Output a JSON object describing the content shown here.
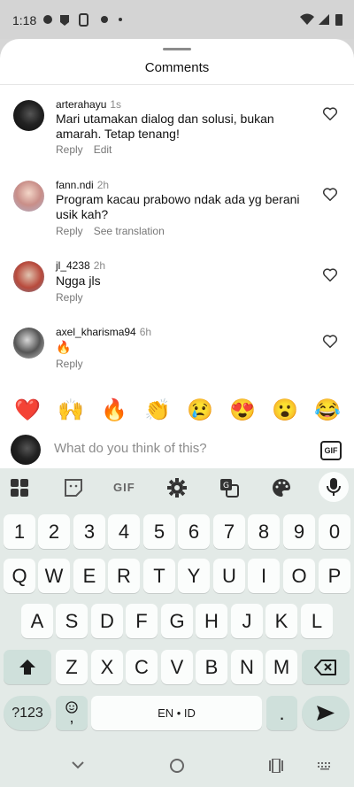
{
  "status_bar": {
    "time": "1:18"
  },
  "sheet": {
    "title": "Comments"
  },
  "comments": [
    {
      "username": "arterahayu",
      "time": "1s",
      "text_line1": "Mari utamakan dialog dan solusi, bukan",
      "text_line2": "amarah. Tetap tenang!",
      "action1": "Reply",
      "action2": "Edit"
    },
    {
      "username": "fann.ndi",
      "time": "2h",
      "text_line1": "Program kacau prabowo ndak ada yg  berani",
      "text_line2": "usik kah?",
      "action1": "Reply",
      "action2": "See translation"
    },
    {
      "username": "jl_4238",
      "time": "2h",
      "text_line1": "Ngga jls",
      "text_line2": "",
      "action1": "Reply",
      "action2": ""
    },
    {
      "username": "axel_kharisma94",
      "time": "6h",
      "text_line1": "🔥",
      "text_line2": "",
      "action1": "Reply",
      "action2": ""
    }
  ],
  "emoji_bar": [
    "❤️",
    "🙌",
    "🔥",
    "👏",
    "😢",
    "😍",
    "😮",
    "😂"
  ],
  "input": {
    "placeholder": "What do you think of this?",
    "gif_label": "GIF"
  },
  "keyboard": {
    "toolbar_gif": "GIF",
    "row_numbers": [
      "1",
      "2",
      "3",
      "4",
      "5",
      "6",
      "7",
      "8",
      "9",
      "0"
    ],
    "row1": [
      "Q",
      "W",
      "E",
      "R",
      "T",
      "Y",
      "U",
      "I",
      "O",
      "P"
    ],
    "row2": [
      "A",
      "S",
      "D",
      "F",
      "G",
      "H",
      "J",
      "K",
      "L"
    ],
    "row3": [
      "Z",
      "X",
      "C",
      "V",
      "B",
      "N",
      "M"
    ],
    "symbols_key": "?123",
    "comma_key": ",",
    "space_label": "EN • ID",
    "period_key": "."
  },
  "colors": {
    "accent": "#cfe0db",
    "keyboard_bg": "#e3eae7"
  }
}
